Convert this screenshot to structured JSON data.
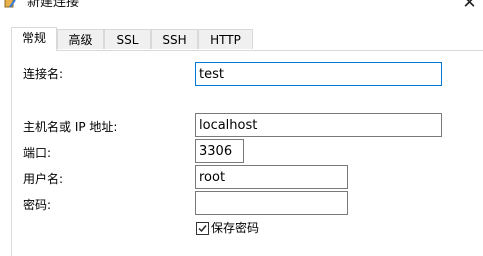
{
  "window": {
    "title": "新建连接",
    "close_glyph": "✕"
  },
  "tabs": [
    {
      "label": "常规",
      "active": true
    },
    {
      "label": "高级",
      "active": false
    },
    {
      "label": "SSL",
      "active": false
    },
    {
      "label": "SSH",
      "active": false
    },
    {
      "label": "HTTP",
      "active": false
    }
  ],
  "form": {
    "connection_name": {
      "label": "连接名:",
      "value": "test"
    },
    "host": {
      "label": "主机名或 IP 地址:",
      "value": "localhost"
    },
    "port": {
      "label": "端口:",
      "value": "3306"
    },
    "username": {
      "label": "用户名:",
      "value": "root"
    },
    "password": {
      "label": "密码:",
      "value": ""
    },
    "save_password": {
      "label": "保存密码",
      "checked": true
    }
  },
  "colors": {
    "focus_border": "#0078d7",
    "field_border": "#7a7a7a",
    "tab_border": "#d9d9d9"
  }
}
